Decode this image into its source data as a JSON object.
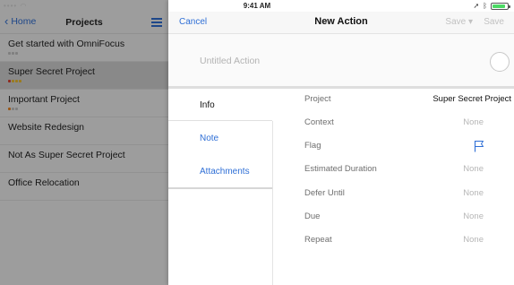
{
  "status_bar": {
    "left": "•••• ",
    "time": "9:41 AM",
    "battery_fraction": 0.85
  },
  "left_pane": {
    "back_label": "Home",
    "title": "Projects",
    "projects": [
      {
        "name": "Get started with OmniFocus",
        "selected": false,
        "marks": [
          "grey",
          "grey",
          "grey"
        ]
      },
      {
        "name": "Super Secret Project",
        "selected": true,
        "marks": [
          "red",
          "yellow",
          "yellow",
          "yellow"
        ]
      },
      {
        "name": "Important Project",
        "selected": false,
        "marks": [
          "orange",
          "grey",
          "grey"
        ]
      },
      {
        "name": "Website Redesign",
        "selected": false,
        "marks": []
      },
      {
        "name": "Not As Super Secret Project",
        "selected": false,
        "marks": []
      },
      {
        "name": "Office Relocation",
        "selected": false,
        "marks": []
      }
    ]
  },
  "sheet": {
    "cancel_label": "Cancel",
    "title": "New Action",
    "save_menu_label": "Save ▾",
    "save_label": "Save",
    "title_placeholder": "Untitled Action",
    "tabs": {
      "info": "Info",
      "note": "Note",
      "attachments": "Attachments"
    },
    "fields": {
      "project": {
        "label": "Project",
        "value": "Super Secret Project"
      },
      "context": {
        "label": "Context",
        "value": "None"
      },
      "flag": {
        "label": "Flag",
        "icon": "flag-outline-icon"
      },
      "estimated_duration": {
        "label": "Estimated Duration",
        "value": "None"
      },
      "defer_until": {
        "label": "Defer Until",
        "value": "None"
      },
      "due": {
        "label": "Due",
        "value": "None"
      },
      "repeat": {
        "label": "Repeat",
        "value": "None"
      }
    }
  },
  "colors": {
    "accent": "#2f6fd6",
    "disabled": "#c2c2c2",
    "placeholder": "#b3b3b3"
  }
}
